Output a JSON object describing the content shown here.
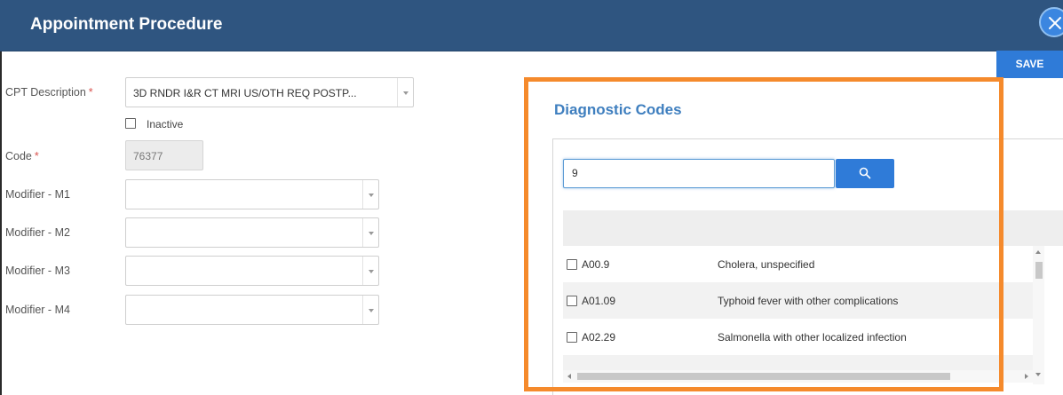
{
  "header": {
    "title": "Appointment Procedure"
  },
  "actions": {
    "save_label": "SAVE",
    "close_icon": "close-icon"
  },
  "form": {
    "cpt_description": {
      "label": "CPT Description",
      "required": "*",
      "value": "3D RNDR I&R CT MRI US/OTH REQ POSTP..."
    },
    "inactive": {
      "label": "Inactive",
      "checked": false
    },
    "code": {
      "label": "Code",
      "required": "*",
      "value": "76377"
    },
    "modifier_m1": {
      "label": "Modifier - M1",
      "value": ""
    },
    "modifier_m2": {
      "label": "Modifier - M2",
      "value": ""
    },
    "modifier_m3": {
      "label": "Modifier - M3",
      "value": ""
    },
    "modifier_m4": {
      "label": "Modifier - M4",
      "value": ""
    }
  },
  "diagnostic": {
    "title": "Diagnostic Codes",
    "search_value": "9",
    "search_icon": "search-icon",
    "highlight_color": "#f58a2c",
    "rows": [
      {
        "code": "A00.9",
        "description": "Cholera, unspecified",
        "checked": false
      },
      {
        "code": "A01.09",
        "description": "Typhoid fever with other complications",
        "checked": false
      },
      {
        "code": "A02.29",
        "description": "Salmonella with other localized infection",
        "checked": false
      }
    ]
  },
  "colors": {
    "header_bg": "#2f5580",
    "accent": "#2f7bd8",
    "title_blue": "#3f7fbf"
  }
}
